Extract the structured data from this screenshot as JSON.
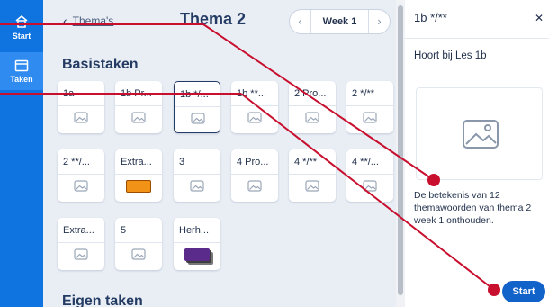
{
  "nav": {
    "items": [
      {
        "label": "Start",
        "icon": "home-icon"
      },
      {
        "label": "Taken",
        "icon": "tasks-icon"
      }
    ]
  },
  "header": {
    "back_label": "Thema's",
    "title": "Thema 2",
    "week_label": "Week 1"
  },
  "sections": {
    "basistaken": "Basistaken",
    "eigen_taken": "Eigen taken"
  },
  "tiles": [
    {
      "label": "1a"
    },
    {
      "label": "1b Pr..."
    },
    {
      "label": "1b */..."
    },
    {
      "label": "1b **..."
    },
    {
      "label": "2 Pro..."
    },
    {
      "label": "2 */**"
    },
    {
      "label": "2 **/..."
    },
    {
      "label": "Extra..."
    },
    {
      "label": "3"
    },
    {
      "label": "4 Pro..."
    },
    {
      "label": "4 */**"
    },
    {
      "label": "4 **/..."
    },
    {
      "label": "Extra..."
    },
    {
      "label": "5"
    },
    {
      "label": "Herh..."
    }
  ],
  "detail": {
    "title": "1b */**",
    "subtitle": "Hoort bij Les 1b",
    "description": "De betekenis van 12 themawoorden van thema 2 week 1 onthouden.",
    "start_label": "Start"
  },
  "colors": {
    "nav_bg": "#0f74e0",
    "accent": "#1163c9",
    "annotation": "#c8102e",
    "title": "#243b63"
  }
}
